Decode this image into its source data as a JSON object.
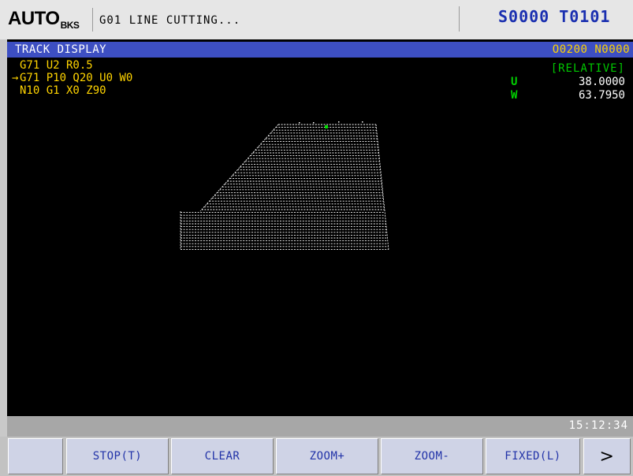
{
  "header": {
    "mode": "AUTO",
    "mode_sub": "BKS",
    "status": "G01 LINE CUTTING...",
    "spindle": "S0000",
    "tool": "T0101"
  },
  "screen": {
    "title": "TRACK DISPLAY",
    "program": "O0200 N0000",
    "code_lines": [
      {
        "arrow": "",
        "text": "G71 U2 R0.5"
      },
      {
        "arrow": "→",
        "text": "G71 P10 Q20 U0 W0"
      },
      {
        "arrow": "",
        "text": "N10 G1 X0 Z90"
      }
    ],
    "coord_mode": "[RELATIVE]",
    "coords": [
      {
        "axis": "U",
        "value": "38.0000"
      },
      {
        "axis": "W",
        "value": "63.7950"
      }
    ]
  },
  "statusbar": {
    "time": "15:12:34"
  },
  "softkeys": [
    "",
    "STOP(T)",
    "CLEAR",
    "ZOOM+",
    "ZOOM-",
    "FIXED(L)",
    ">"
  ],
  "colors": {
    "title_bar": "#3d4fc2",
    "code_text": "#ffd400",
    "axis_green": "#00d000",
    "key_text": "#2233a8",
    "track": "#ffffff"
  }
}
